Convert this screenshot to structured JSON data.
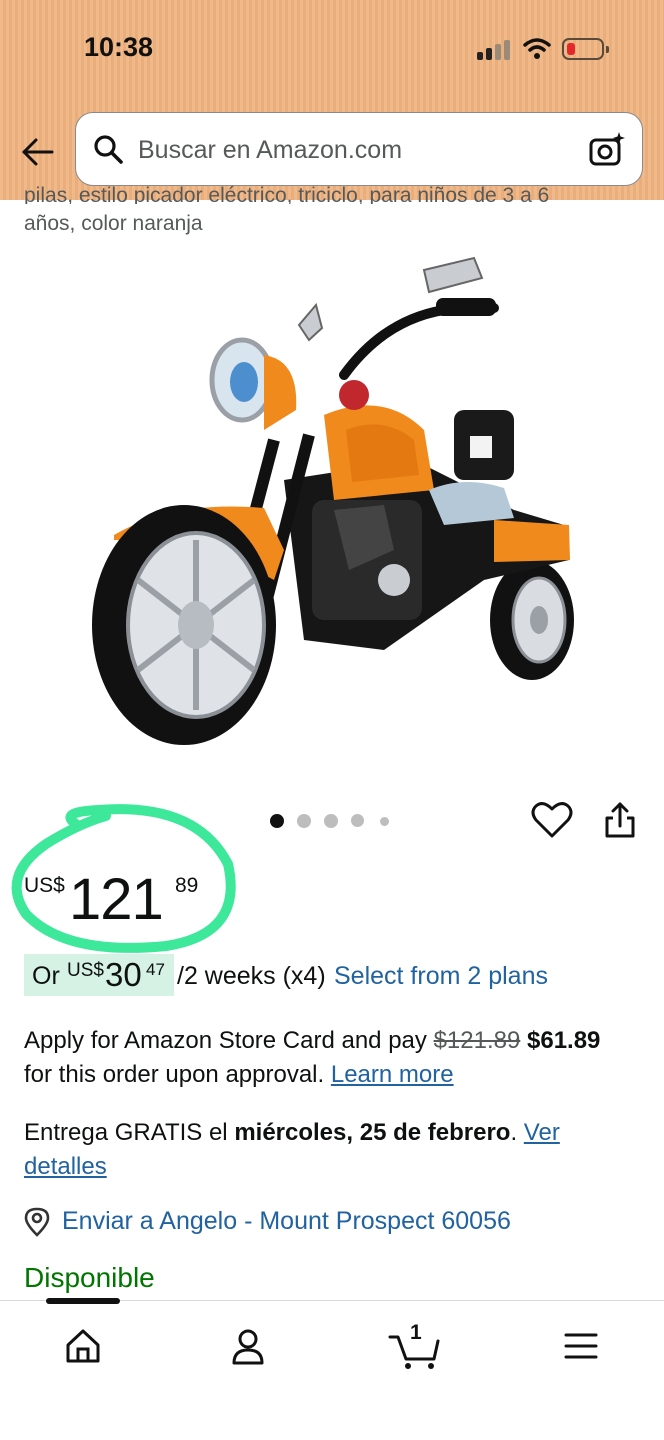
{
  "status_bar": {
    "time": "10:38"
  },
  "search": {
    "placeholder": "Buscar en Amazon.com"
  },
  "product": {
    "title_partial_line": "pilas, estilo picador eléctrico, triciclo, para niños de 3 a 6",
    "title_last_line": "años, color naranja",
    "image_icon": "product-photo-orange-motorcycle-trike",
    "carousel": {
      "total": 5,
      "active": 1
    }
  },
  "price": {
    "currency": "US$",
    "whole": "121",
    "fraction": "89"
  },
  "installments": {
    "prefix": "Or",
    "currency": "US$",
    "whole": "30",
    "fraction": "47",
    "period": "/2 weeks (x4)",
    "plans_link": "Select from 2 plans"
  },
  "store_card": {
    "text_before": "Apply for Amazon Store Card and pay ",
    "old_price": "$121.89",
    "new_price": "$61.89",
    "text_after": "for this order upon approval. ",
    "learn_more": "Learn more"
  },
  "delivery": {
    "prefix": "Entrega GRATIS el ",
    "date": "miércoles, 25 de febrero",
    "suffix": ". ",
    "details_link": "Ver detalles"
  },
  "ship_to": "Enviar a Angelo - Mount Prospect 60056",
  "availability": "Disponible",
  "bottom_nav": {
    "cart_count": "1"
  },
  "colors": {
    "link": "#2162a1",
    "in_stock": "#007600",
    "header_bg": "#f0b98a",
    "price_annotation": "#3ee89a",
    "installment_highlight": "#d6f2e4"
  }
}
